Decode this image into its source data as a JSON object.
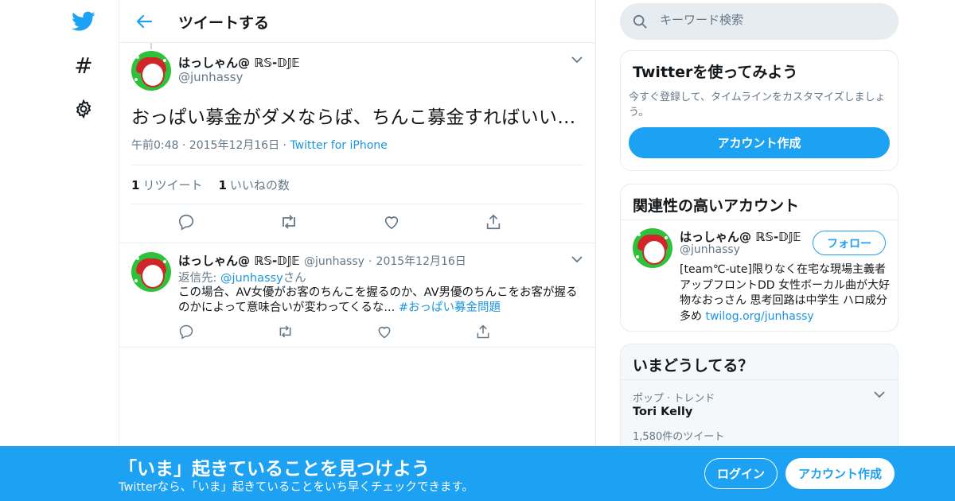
{
  "colors": {
    "accent": "#1da1f2",
    "text": "#14171a",
    "muted": "#657786",
    "link": "#1b95e0",
    "border": "#e6ecf0"
  },
  "nav": {
    "icons": [
      "twitter-bird-icon",
      "hashtag-icon",
      "gear-icon"
    ],
    "hashtag_glyph": "#"
  },
  "header": {
    "title": "ツイートする"
  },
  "tweet": {
    "name": "はっしゃん@ ℝ𝕊-𝔻𝕁𝔼",
    "handle": "@junhassy",
    "text": "おっぱい募金がダメならば、ちんこ募金すればいい…",
    "time": "午前0:48",
    "sep": "·",
    "date": "2015年12月16日",
    "source": "Twitter for iPhone",
    "retweet_count": "1",
    "retweet_label": "リツイート",
    "like_count": "1",
    "like_label": "いいねの数"
  },
  "reply": {
    "name": "はっしゃん@ ℝ𝕊-𝔻𝕁𝔼",
    "handle": "@junhassy",
    "sep": "·",
    "date": "2015年12月16日",
    "reply_to_prefix": "返信先: ",
    "reply_to_handle": "@junhassy",
    "reply_to_suffix": "さん",
    "text": "この場合、AV女優がお客のちんこを握るのか、AV男優のちんこをお客が握るのかによって意味合いが変わってくるな... ",
    "hashtag": "#おっぱい募金問題"
  },
  "search": {
    "placeholder": "キーワード検索"
  },
  "signup_card": {
    "title": "Twitterを使ってみよう",
    "desc": "今すぐ登録して、タイムラインをカスタマイズしましょう。",
    "button": "アカウント作成"
  },
  "related_card": {
    "title": "関連性の高いアカウント",
    "name": "はっしゃん@ ℝ𝕊-𝔻𝕁𝔼",
    "handle": "@junhassy",
    "follow": "フォロー",
    "bio": "[team℃-ute]限りなく在宅な現場主義者 アップフロントDD 女性ボーカル曲が大好物なおっさん 思考回路は中学生 ハロ成分多め ",
    "bio_link": "twilog.org/junhassy"
  },
  "trends_card": {
    "title": "いまどうしてる？",
    "context": "ポップ · トレンド",
    "trend": "Tori Kelly",
    "count": "1,580件のツイート"
  },
  "banner": {
    "title": "「いま」起きていることを見つけよう",
    "subtitle": "Twitterなら、「いま」起きていることをいち早くチェックできます。",
    "login": "ログイン",
    "signup": "アカウント作成"
  }
}
